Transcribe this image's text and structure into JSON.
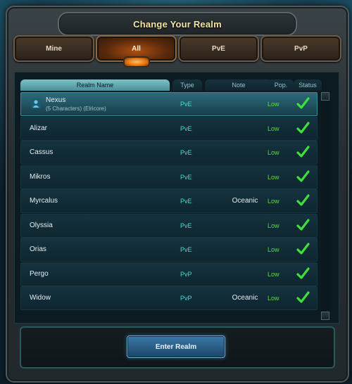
{
  "window": {
    "title": "Change Your Realm"
  },
  "tabs": [
    {
      "label": "Mine"
    },
    {
      "label": "All",
      "active": true
    },
    {
      "label": "PvE"
    },
    {
      "label": "PvP"
    }
  ],
  "columns": [
    "Realm Name",
    "Type",
    "Note",
    "Pop.",
    "Status"
  ],
  "realms": [
    {
      "name": "Nexus",
      "sub": "(5 Characters) (Elricore)",
      "type": "PvE",
      "note": "",
      "pop": "Low",
      "status": "check-icon"
    },
    {
      "name": "Alizar",
      "type": "PvE",
      "note": "",
      "pop": "Low",
      "status": "check-icon"
    },
    {
      "name": "Cassus",
      "type": "PvE",
      "note": "",
      "pop": "Low",
      "status": "check-icon"
    },
    {
      "name": "Mikros",
      "type": "PvE",
      "note": "",
      "pop": "Low",
      "status": "check-icon"
    },
    {
      "name": "Myrcalus",
      "type": "PvE",
      "note": "Oceanic",
      "pop": "Low",
      "status": "check-icon"
    },
    {
      "name": "Olyssia",
      "type": "PvE",
      "note": "",
      "pop": "Low",
      "status": "check-icon"
    },
    {
      "name": "Orias",
      "type": "PvE",
      "note": "",
      "pop": "Low",
      "status": "check-icon"
    },
    {
      "name": "Pergo",
      "type": "PvP",
      "note": "",
      "pop": "Low",
      "status": "check-icon"
    },
    {
      "name": "Widow",
      "type": "PvP",
      "note": "Oceanic",
      "pop": "Low",
      "status": "check-icon"
    }
  ],
  "footer": {
    "enter_label": "Enter Realm"
  },
  "colors": {
    "type": "#3fe0c8",
    "pop": "#5cdc3a",
    "check": "#3ee03a",
    "title": "#f4e2a6"
  }
}
